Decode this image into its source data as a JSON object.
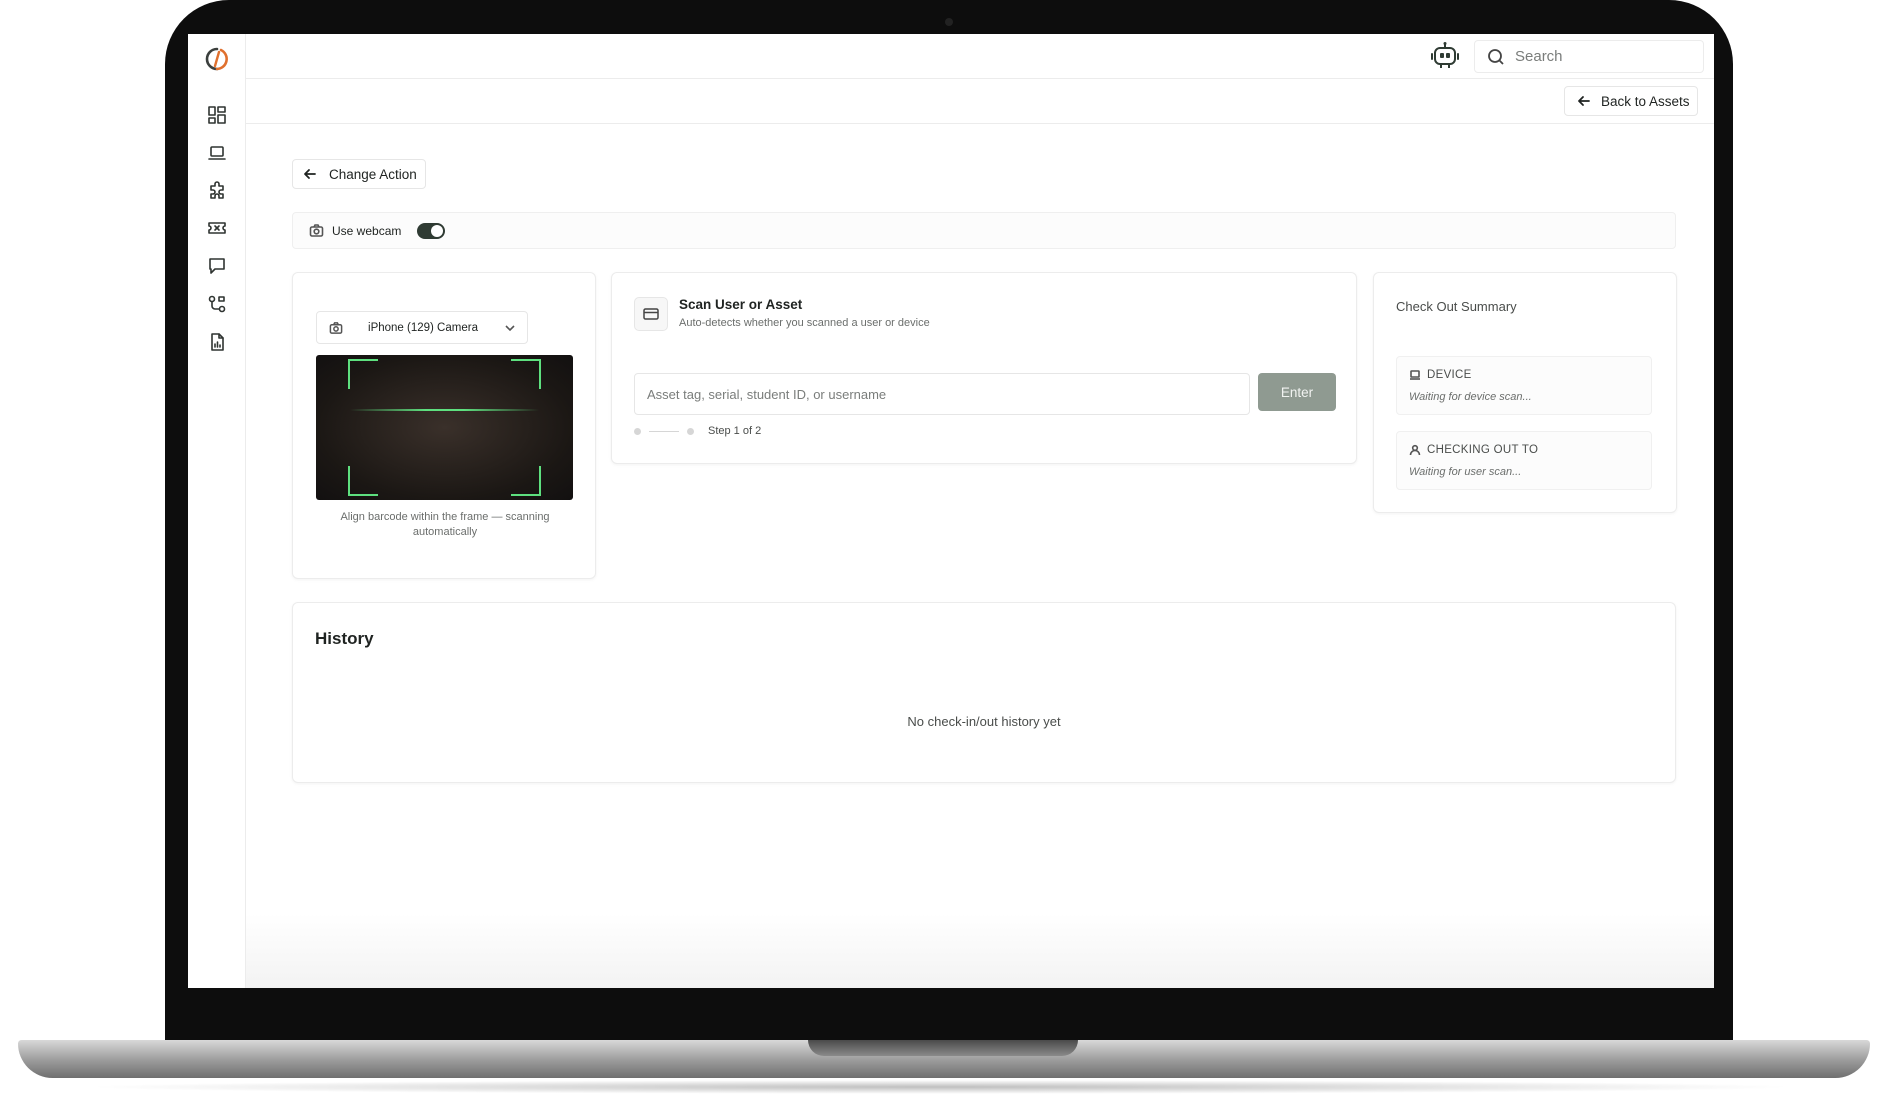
{
  "topbar": {
    "search_placeholder": "Search",
    "assistant_icon": "robot-icon",
    "avatar_icon": "user-avatar"
  },
  "sidebar": {
    "items": [
      {
        "icon": "dashboard-icon"
      },
      {
        "icon": "laptop-icon"
      },
      {
        "icon": "puzzle-icon"
      },
      {
        "icon": "ticket-icon"
      },
      {
        "icon": "chat-icon"
      },
      {
        "icon": "workflow-icon"
      },
      {
        "icon": "report-icon"
      }
    ]
  },
  "subbar": {
    "back_label": "Back to Assets"
  },
  "actions": {
    "change_action_label": "Change Action",
    "webcam_label": "Use webcam",
    "webcam_enabled": true
  },
  "camera": {
    "selected_camera": "iPhone (129) Camera",
    "hint": "Align barcode within the frame — scanning automatically",
    "scanner_color": "#5ee07f"
  },
  "scan": {
    "title": "Scan User or Asset",
    "subtitle": "Auto-detects whether you scanned a user or device",
    "input_placeholder": "Asset tag, serial, student ID, or username",
    "enter_label": "Enter",
    "step_label": "Step 1 of 2"
  },
  "summary": {
    "title": "Check Out Summary",
    "device_label": "DEVICE",
    "device_value": "Waiting for device scan...",
    "user_label": "CHECKING OUT TO",
    "user_value": "Waiting for user scan..."
  },
  "history": {
    "title": "History",
    "empty_text": "No check-in/out history yet"
  },
  "colors": {
    "accent": "#2f3b33",
    "button_disabled": "#8f9a91"
  }
}
